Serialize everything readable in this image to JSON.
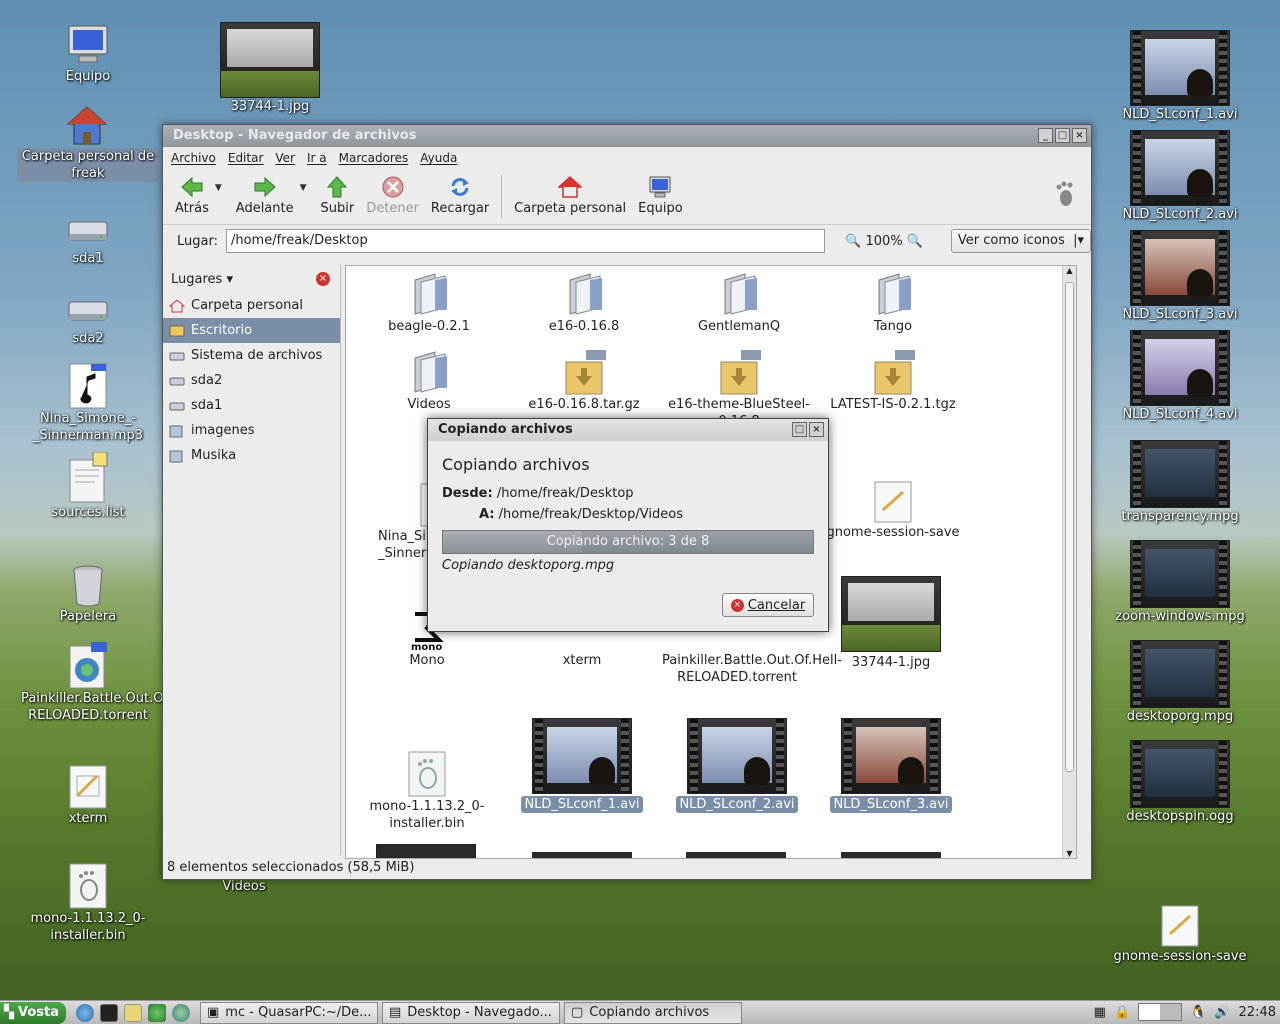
{
  "desktop": {
    "left_icons": [
      {
        "label": "Equipo"
      },
      {
        "label": "Carpeta personal de freak"
      },
      {
        "label": "sda1"
      },
      {
        "label": "sda2"
      },
      {
        "label": "Nina_Simone_-_Sinnerman.mp3"
      },
      {
        "label": "sources.list"
      },
      {
        "label": "Papelera"
      },
      {
        "label": "Painkiller.Battle.Out.Of.Hell-RELOADED.torrent"
      },
      {
        "label": "xterm"
      },
      {
        "label": "mono-1.1.13.2_0-installer.bin"
      }
    ],
    "top_icon": {
      "label": "33744-1.jpg"
    },
    "videos_icon": {
      "label": "Videos"
    },
    "right_icons": [
      {
        "label": "NLD_SLconf_1.avi"
      },
      {
        "label": "NLD_SLconf_2.avi"
      },
      {
        "label": "NLD_SLconf_3.avi"
      },
      {
        "label": "NLD_SLconf_4.avi"
      },
      {
        "label": "transparency.mpg"
      },
      {
        "label": "zoom-windows.mpg"
      },
      {
        "label": "desktoporg.mpg"
      },
      {
        "label": "desktopspin.ogg"
      }
    ],
    "gnome_save": {
      "label": "gnome-session-save"
    }
  },
  "filemanager": {
    "title": "Desktop - Navegador de archivos",
    "menu": [
      "Archivo",
      "Editar",
      "Ver",
      "Ir a",
      "Marcadores",
      "Ayuda"
    ],
    "toolbar": {
      "back": "Atrás",
      "forward": "Adelante",
      "up": "Subir",
      "stop": "Detener",
      "reload": "Recargar",
      "home": "Carpeta personal",
      "computer": "Equipo"
    },
    "location_label": "Lugar:",
    "location_value": "/home/freak/Desktop",
    "zoom": "100%",
    "view_mode": "Ver como iconos",
    "sidebar": {
      "header": "Lugares",
      "items": [
        {
          "label": "Carpeta personal"
        },
        {
          "label": "Escritorio"
        },
        {
          "label": "Sistema de archivos"
        },
        {
          "label": "sda2"
        },
        {
          "label": "sda1"
        },
        {
          "label": "imagenes"
        },
        {
          "label": "Musika"
        }
      ]
    },
    "files": [
      {
        "label": "beagle-0.2.1"
      },
      {
        "label": "e16-0.16.8"
      },
      {
        "label": "GentlemanQ"
      },
      {
        "label": "Tango"
      },
      {
        "label": "Videos"
      },
      {
        "label": "e16-0.16.8.tar.gz"
      },
      {
        "label": "e16-theme-BlueSteel-0.16.8"
      },
      {
        "label": "LATEST-IS-0.2.1.tgz"
      },
      {
        "label": "Nina_Simone_-_Sinnerman.mp3"
      },
      {
        "label": "gnome-session-save"
      },
      {
        "label": "Mono"
      },
      {
        "label": "xterm"
      },
      {
        "label": "Painkiller.Battle.Out.Of.Hell-RELOADED.torrent"
      },
      {
        "label": "33744-1.jpg"
      },
      {
        "label": "mono-1.1.13.2_0-installer.bin"
      },
      {
        "label": "NLD_SLconf_1.avi"
      },
      {
        "label": "NLD_SLconf_2.avi"
      },
      {
        "label": "NLD_SLconf_3.avi"
      }
    ],
    "status": "8 elementos seleccionados (58,5 MiB)"
  },
  "dialog": {
    "title": "Copiando archivos",
    "heading": "Copiando archivos",
    "from_label": "Desde:",
    "from_value": "/home/freak/Desktop",
    "to_label": "A:",
    "to_value": "/home/freak/Desktop/Videos",
    "progress_text": "Copiando archivo: 3 de 8",
    "progress_fraction": 0.375,
    "current": "Copiando  desktoporg.mpg",
    "cancel": "Cancelar"
  },
  "taskbar": {
    "start": "Vosta",
    "tasks": [
      {
        "label": "mc - QuasarPC:~/De..."
      },
      {
        "label": "Desktop - Navegado..."
      },
      {
        "label": "Copiando archivos"
      }
    ],
    "clock": "22:48"
  },
  "colors": {
    "selection": "#7b8ea8",
    "start_green": "#3e8f3a"
  }
}
